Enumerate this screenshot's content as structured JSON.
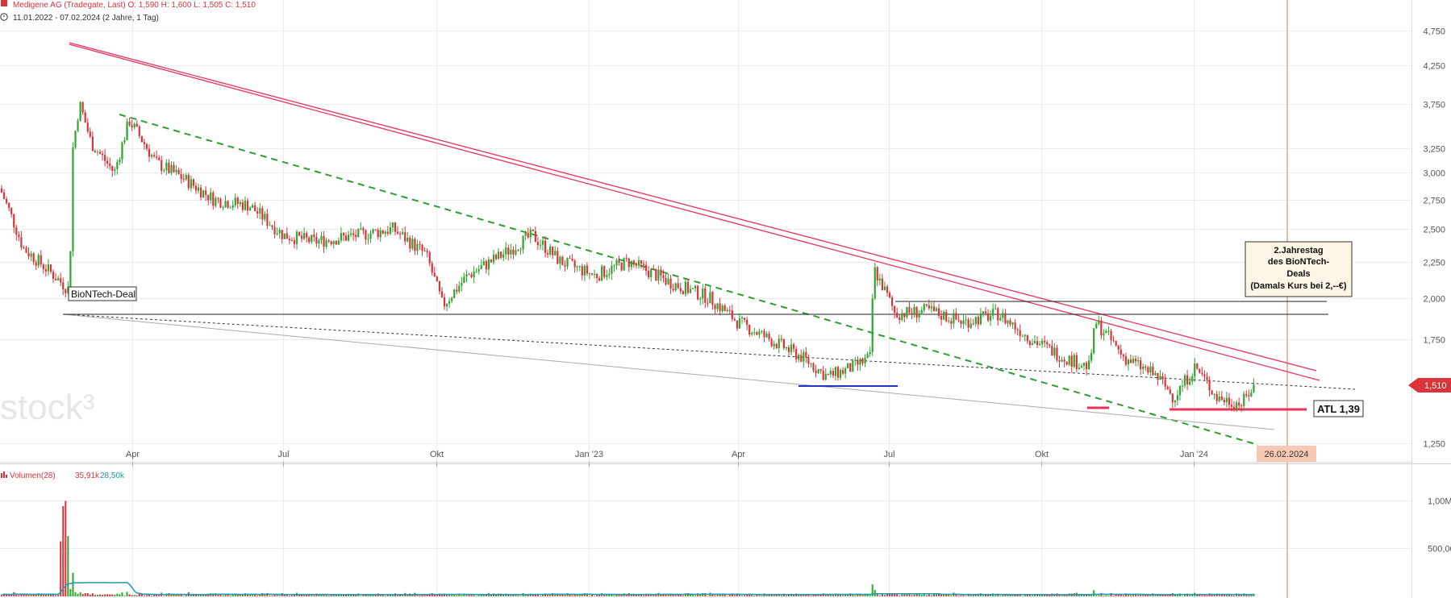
{
  "header": {
    "title_line": "Medigene AG (Tradegate, Last)  O: 1,590  H: 1,600  L: 1,505  C: 1,510",
    "range_line": "11.01.2022 - 07.02.2024   (2 Jahre, 1 Tag)",
    "clock_icon": "clock-icon"
  },
  "watermark": "stock³",
  "colors": {
    "up": "#2ea52e",
    "down": "#d9343a",
    "trend_red": "#e8345a",
    "trend_green": "#2e9e2e",
    "support_blue": "#2233cc",
    "atl_red": "#e8345a",
    "marker_line": "#f4b9a0",
    "vol_avg": "#1e9ab0"
  },
  "price_axis": {
    "ticks": [
      "4,750",
      "4,250",
      "3,750",
      "3,250",
      "3,000",
      "2,750",
      "2,500",
      "2,250",
      "2,000",
      "1,750",
      "1,250"
    ],
    "last_price": "1,510"
  },
  "time_axis": {
    "ticks": [
      "Apr",
      "Jul",
      "Okt",
      "Jan '23",
      "Apr",
      "Jul",
      "Okt",
      "Jan '24"
    ],
    "marker_date": "26.02.2024"
  },
  "volume": {
    "legend_label": "Volumen(28)",
    "legend_value1": "35,91k",
    "legend_value2": "28,50k",
    "ticks": [
      "1,00M",
      "500,00K"
    ]
  },
  "annotations": {
    "biontech_deal": "BioNTech-Deal",
    "anniversary": [
      "2.Jahrestag",
      "des BioNTech-",
      "Deals",
      "(Damals Kurs bei 2,--€)"
    ],
    "atl": "ATL 1,39"
  },
  "chart_data": {
    "type": "candlestick",
    "title": "Medigene AG (Tradegate, Last)",
    "date_range": [
      "2022-01-11",
      "2024-02-07"
    ],
    "ohlc_last": {
      "open": 1.59,
      "high": 1.6,
      "low": 1.505,
      "close": 1.51
    },
    "price_series_approx": [
      {
        "date": "2022-01-11",
        "close": 2.85
      },
      {
        "date": "2022-01-25",
        "close": 2.35
      },
      {
        "date": "2022-02-08",
        "close": 2.2
      },
      {
        "date": "2022-02-22",
        "close": 2.05
      },
      {
        "date": "2022-02-24",
        "close": 3.25
      },
      {
        "date": "2022-02-28",
        "close": 3.75
      },
      {
        "date": "2022-03-07",
        "close": 3.3
      },
      {
        "date": "2022-03-21",
        "close": 3.0
      },
      {
        "date": "2022-03-30",
        "close": 3.55
      },
      {
        "date": "2022-04-15",
        "close": 3.1
      },
      {
        "date": "2022-05-01",
        "close": 2.95
      },
      {
        "date": "2022-05-20",
        "close": 2.75
      },
      {
        "date": "2022-06-10",
        "close": 2.7
      },
      {
        "date": "2022-07-01",
        "close": 2.45
      },
      {
        "date": "2022-07-20",
        "close": 2.4
      },
      {
        "date": "2022-08-15",
        "close": 2.45
      },
      {
        "date": "2022-09-05",
        "close": 2.5
      },
      {
        "date": "2022-09-25",
        "close": 2.3
      },
      {
        "date": "2022-10-05",
        "close": 1.95
      },
      {
        "date": "2022-10-20",
        "close": 2.15
      },
      {
        "date": "2022-11-10",
        "close": 2.3
      },
      {
        "date": "2022-11-28",
        "close": 2.45
      },
      {
        "date": "2022-12-15",
        "close": 2.25
      },
      {
        "date": "2023-01-05",
        "close": 2.15
      },
      {
        "date": "2023-01-25",
        "close": 2.25
      },
      {
        "date": "2023-02-20",
        "close": 2.1
      },
      {
        "date": "2023-03-15",
        "close": 2.0
      },
      {
        "date": "2023-04-01",
        "close": 1.85
      },
      {
        "date": "2023-04-20",
        "close": 1.75
      },
      {
        "date": "2023-05-10",
        "close": 1.65
      },
      {
        "date": "2023-05-25",
        "close": 1.55
      },
      {
        "date": "2023-06-10",
        "close": 1.6
      },
      {
        "date": "2023-06-20",
        "close": 1.65
      },
      {
        "date": "2023-06-22",
        "close": 2.2
      },
      {
        "date": "2023-07-05",
        "close": 1.9
      },
      {
        "date": "2023-07-25",
        "close": 1.92
      },
      {
        "date": "2023-08-15",
        "close": 1.85
      },
      {
        "date": "2023-09-05",
        "close": 1.9
      },
      {
        "date": "2023-09-25",
        "close": 1.75
      },
      {
        "date": "2023-10-15",
        "close": 1.65
      },
      {
        "date": "2023-10-30",
        "close": 1.6
      },
      {
        "date": "2023-11-03",
        "close": 1.85
      },
      {
        "date": "2023-11-20",
        "close": 1.65
      },
      {
        "date": "2023-12-10",
        "close": 1.55
      },
      {
        "date": "2023-12-20",
        "close": 1.45
      },
      {
        "date": "2024-01-02",
        "close": 1.6
      },
      {
        "date": "2024-01-15",
        "close": 1.45
      },
      {
        "date": "2024-01-30",
        "close": 1.42
      },
      {
        "date": "2024-02-06",
        "close": 1.5
      },
      {
        "date": "2024-02-07",
        "close": 1.51
      }
    ],
    "ylim_approx": [
      1.2,
      4.9
    ],
    "y_scale": "log",
    "grid": true,
    "volume_peak": 1200000
  }
}
